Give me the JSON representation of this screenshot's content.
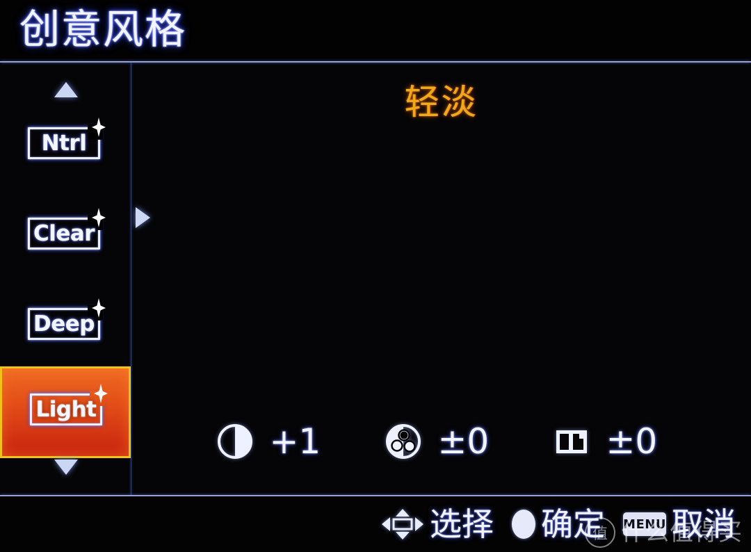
{
  "header": {
    "title": "创意风格"
  },
  "sidebar": {
    "scroll_up_icon": "triangle-up-icon",
    "scroll_down_icon": "triangle-down-icon",
    "items": [
      {
        "label": "Ntrl",
        "name": "ntrl",
        "selected": false,
        "badge_icon": "sparkle-icon"
      },
      {
        "label": "Clear",
        "name": "clear",
        "selected": false,
        "badge_icon": "sparkle-icon"
      },
      {
        "label": "Deep",
        "name": "deep",
        "selected": false,
        "badge_icon": "sparkle-icon"
      },
      {
        "label": "Light",
        "name": "light",
        "selected": true,
        "badge_icon": "sparkle-icon"
      }
    ],
    "selected_index": 3,
    "selection_border_color": "#f2c218",
    "selection_fill_top": "#ef6a22",
    "selection_fill_bottom": "#c8230f"
  },
  "main": {
    "style_name": "轻淡",
    "style_name_color": "#f0a81c",
    "cursor_icon": "triangle-right-icon",
    "parameters": [
      {
        "name": "contrast",
        "icon": "contrast-icon",
        "value": "+1"
      },
      {
        "name": "saturation",
        "icon": "saturation-icon",
        "value": "±0"
      },
      {
        "name": "sharpness",
        "icon": "sharpness-icon",
        "value": "±0"
      }
    ]
  },
  "status_bar": {
    "items": [
      {
        "name": "select",
        "icon": "dpad-icon",
        "label": "选择"
      },
      {
        "name": "confirm",
        "icon": "set-dot-icon",
        "label": "确定"
      },
      {
        "name": "cancel",
        "icon": "menu-button",
        "icon_label": "MENU",
        "label": "取消"
      }
    ]
  },
  "watermark": {
    "badge": "值",
    "text": "什么值得买"
  }
}
